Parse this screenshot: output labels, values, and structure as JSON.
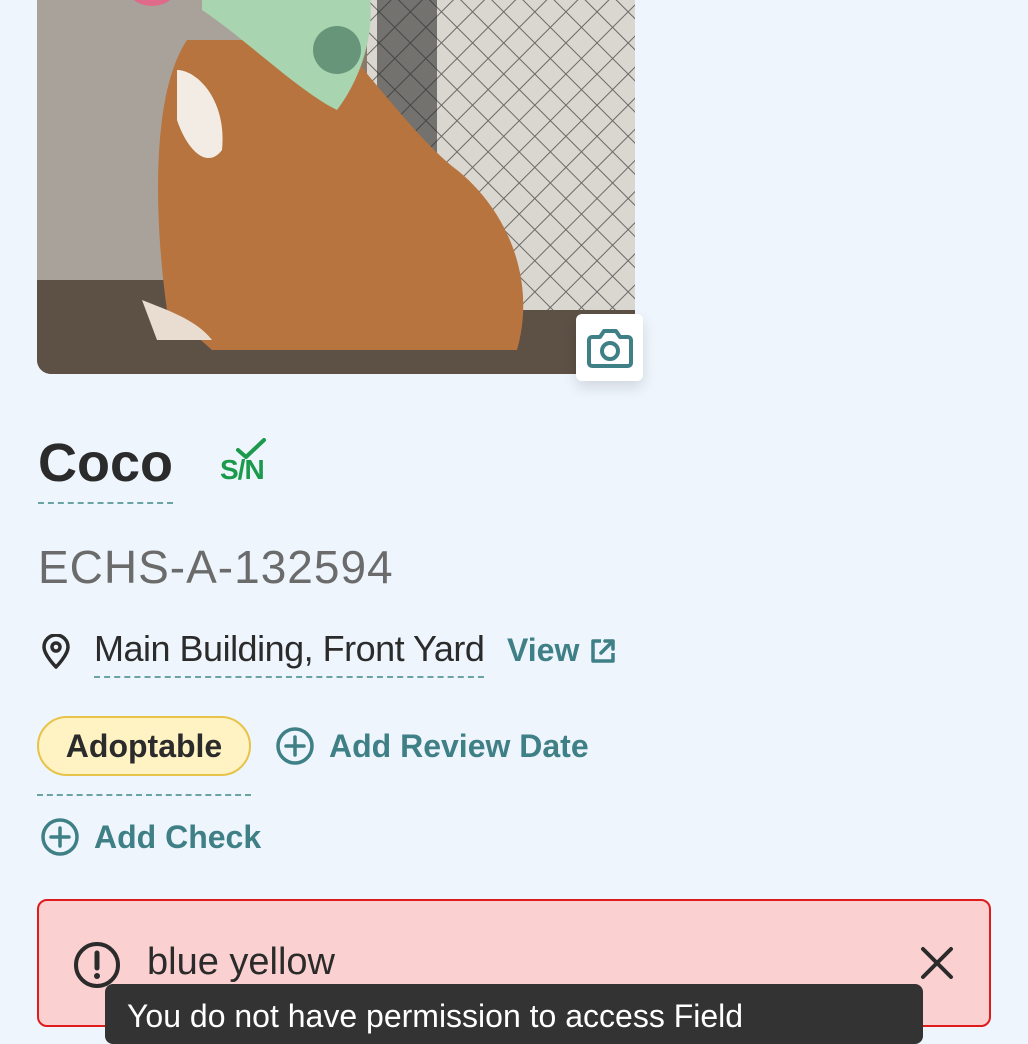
{
  "animal": {
    "name": "Coco",
    "sn_badge": "S/N",
    "id": "ECHS-A-132594",
    "location": "Main Building, Front Yard",
    "view_label": "View",
    "status": "Adoptable"
  },
  "actions": {
    "add_review_date": "Add Review Date",
    "add_check": "Add Check"
  },
  "alert": {
    "text": "blue yellow",
    "tooltip": "You do not have permission to access Field"
  },
  "icons": {
    "camera": "camera-icon",
    "location": "map-pin-icon",
    "external": "external-link-icon",
    "add": "plus-circle-icon",
    "alert": "exclamation-circle-icon",
    "close": "close-icon",
    "check": "check-icon"
  },
  "colors": {
    "accent": "#3f7f86",
    "status_bg": "#fff3c4",
    "status_border": "#e7c34a",
    "alert_bg": "#fbd0d0",
    "alert_border": "#e01b1b",
    "sn_green": "#1a9a4a"
  }
}
